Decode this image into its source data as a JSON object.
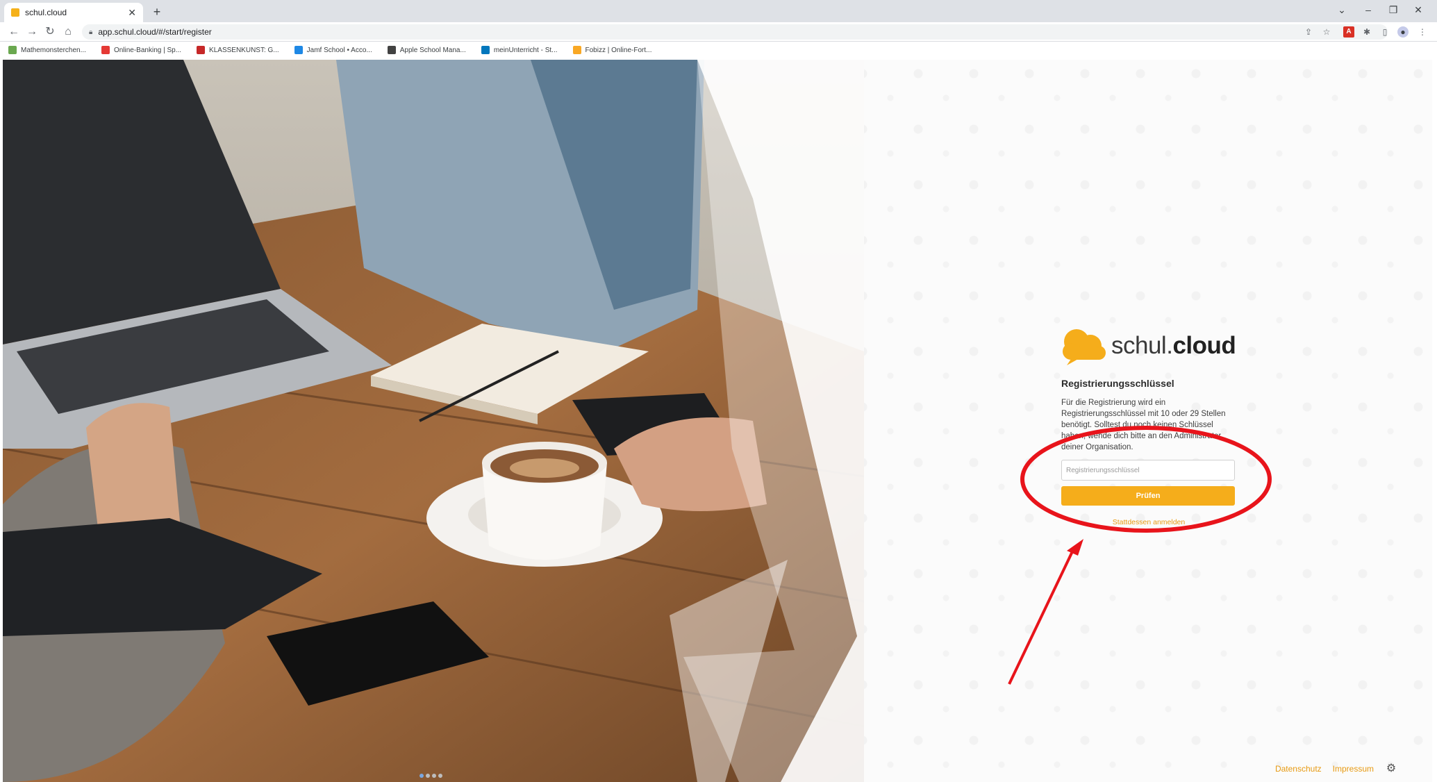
{
  "browser": {
    "tab_title": "schul.cloud",
    "tab_close": "✕",
    "new_tab": "+",
    "url": "app.schul.cloud/#/start/register",
    "bookmarks": [
      {
        "label": "Mathemonsterchen...",
        "color": "#6aa84f"
      },
      {
        "label": "Online-Banking | Sp...",
        "color": "#e53935"
      },
      {
        "label": "KLASSENKUNST: G...",
        "color": "#c62828"
      },
      {
        "label": "Jamf School • Acco...",
        "color": "#1e88e5"
      },
      {
        "label": "Apple School Mana...",
        "color": "#424242"
      },
      {
        "label": "meinUnterricht - St...",
        "color": "#0277bd"
      },
      {
        "label": "Fobizz | Online-Fort...",
        "color": "#f9a825"
      }
    ]
  },
  "brand": {
    "name_regular": "schul.",
    "name_bold": "cloud",
    "accent": "#f5ad1b",
    "link_color": "#e79a12"
  },
  "register": {
    "heading": "Registrierungsschlüssel",
    "description": "Für die Registrierung wird ein Registrierungsschlüssel mit 10 oder 29 Stellen benötigt. Solltest du noch keinen Schlüssel haben, wende dich bitte an den Administrator deiner Organisation.",
    "input_placeholder": "Registrierungsschlüssel",
    "submit_label": "Prüfen",
    "alt_link": "Stattdessen anmelden"
  },
  "footer": {
    "privacy": "Datenschutz",
    "imprint": "Impressum"
  },
  "carousel": {
    "slides": 4,
    "active_index": 0
  },
  "annotation": {
    "color": "#e8141b"
  }
}
